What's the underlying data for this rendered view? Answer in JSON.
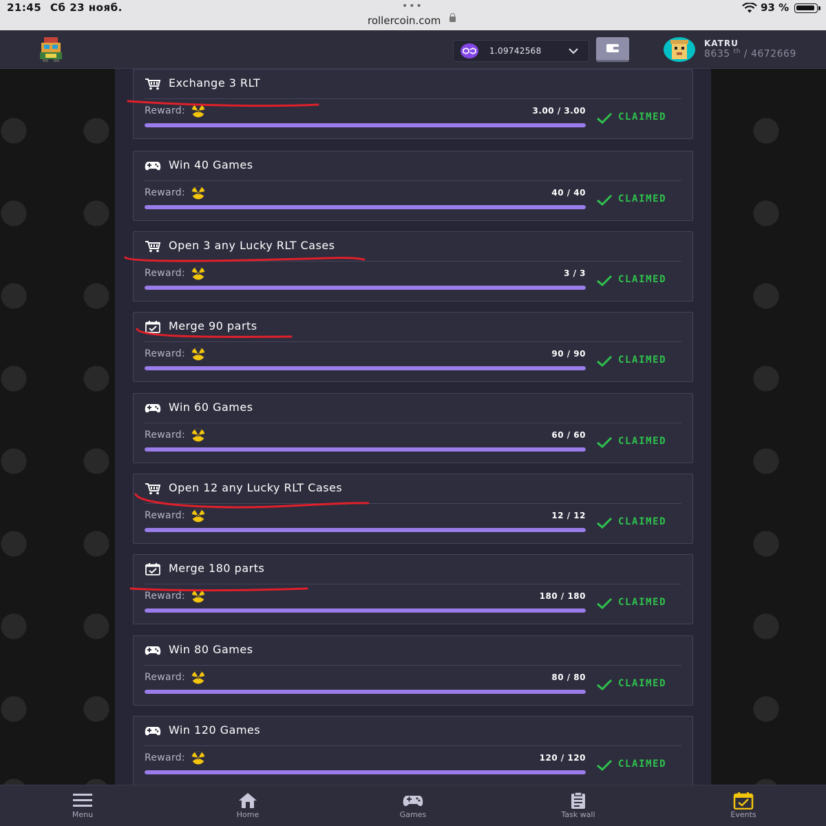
{
  "statusbar": {
    "time": "21:45",
    "date": "Сб 23 нояб.",
    "url": "rollercoin.com",
    "battery": "93 %",
    "battery_level": 0.93
  },
  "header": {
    "balance": "1.09742568",
    "username": "KATRU",
    "rank": "8635",
    "rank_suffix": "th",
    "rank_total": "/ 4672669"
  },
  "tasks": [
    {
      "title": "Exchange 3 RLT",
      "icon": "cart-icon",
      "reward_label": "Reward:",
      "progress_text": "3.00 / 3.00",
      "progress": 1.0,
      "status": "CLAIMED",
      "underline": true
    },
    {
      "title": "Win 40 Games",
      "icon": "gamepad-icon",
      "reward_label": "Reward:",
      "progress_text": "40 / 40",
      "progress": 1.0,
      "status": "CLAIMED",
      "underline": false
    },
    {
      "title": "Open 3 any Lucky RLT Cases",
      "icon": "cart-icon",
      "reward_label": "Reward:",
      "progress_text": "3 / 3",
      "progress": 1.0,
      "status": "CLAIMED",
      "underline": true
    },
    {
      "title": "Merge 90 parts",
      "icon": "calendar-check-icon",
      "reward_label": "Reward:",
      "progress_text": "90 / 90",
      "progress": 1.0,
      "status": "CLAIMED",
      "underline": true
    },
    {
      "title": "Win 60 Games",
      "icon": "gamepad-icon",
      "reward_label": "Reward:",
      "progress_text": "60 / 60",
      "progress": 1.0,
      "status": "CLAIMED",
      "underline": false
    },
    {
      "title": "Open 12 any Lucky RLT Cases",
      "icon": "cart-icon",
      "reward_label": "Reward:",
      "progress_text": "12 / 12",
      "progress": 1.0,
      "status": "CLAIMED",
      "underline": true
    },
    {
      "title": "Merge 180 parts",
      "icon": "calendar-check-icon",
      "reward_label": "Reward:",
      "progress_text": "180 / 180",
      "progress": 1.0,
      "status": "CLAIMED",
      "underline": true
    },
    {
      "title": "Win 80 Games",
      "icon": "gamepad-icon",
      "reward_label": "Reward:",
      "progress_text": "80 / 80",
      "progress": 1.0,
      "status": "CLAIMED",
      "underline": false
    },
    {
      "title": "Win 120 Games",
      "icon": "gamepad-icon",
      "reward_label": "Reward:",
      "progress_text": "120 / 120",
      "progress": 1.0,
      "status": "CLAIMED",
      "underline": false
    }
  ],
  "nav": {
    "menu": "Menu",
    "home": "Home",
    "games": "Games",
    "taskwall": "Task wall",
    "events": "Events"
  },
  "colors": {
    "accent": "#9a7dea",
    "claimed": "#2ec24c",
    "annotation": "#e0202a",
    "events_active": "#f2c40c"
  }
}
